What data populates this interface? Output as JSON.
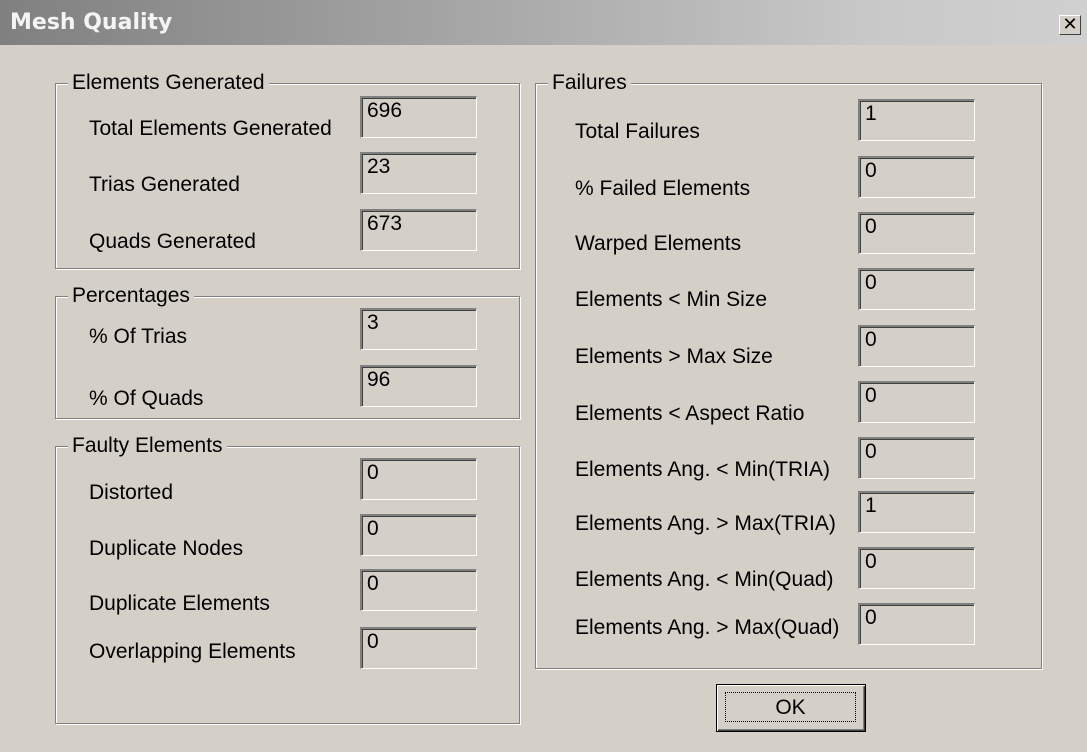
{
  "window": {
    "title": "Mesh Quality",
    "close_glyph": "✕"
  },
  "elements_generated": {
    "legend": "Elements Generated",
    "rows": [
      {
        "label": "Total Elements Generated",
        "value": "696"
      },
      {
        "label": "Trias Generated",
        "value": "23"
      },
      {
        "label": "Quads Generated",
        "value": "673"
      }
    ]
  },
  "percentages": {
    "legend": "Percentages",
    "rows": [
      {
        "label": "% Of Trias",
        "value": "3"
      },
      {
        "label": "% Of Quads",
        "value": "96"
      }
    ]
  },
  "faulty": {
    "legend": "Faulty Elements",
    "rows": [
      {
        "label": "Distorted",
        "value": "0"
      },
      {
        "label": "Duplicate Nodes",
        "value": "0"
      },
      {
        "label": "Duplicate Elements",
        "value": "0"
      },
      {
        "label": "Overlapping Elements",
        "value": "0"
      }
    ]
  },
  "failures": {
    "legend": "Failures",
    "rows": [
      {
        "label": "Total Failures",
        "value": "1"
      },
      {
        "label": "% Failed Elements",
        "value": "0"
      },
      {
        "label": "Warped Elements",
        "value": "0"
      },
      {
        "label": "Elements < Min Size",
        "value": "0"
      },
      {
        "label": "Elements > Max Size",
        "value": "0"
      },
      {
        "label": "Elements < Aspect Ratio",
        "value": "0"
      },
      {
        "label": "Elements Ang. < Min(TRIA)",
        "value": "0"
      },
      {
        "label": "Elements Ang. > Max(TRIA)",
        "value": "1"
      },
      {
        "label": "Elements Ang. < Min(Quad)",
        "value": "0"
      },
      {
        "label": "Elements Ang. > Max(Quad)",
        "value": "0"
      }
    ]
  },
  "buttons": {
    "ok_label": "OK"
  }
}
